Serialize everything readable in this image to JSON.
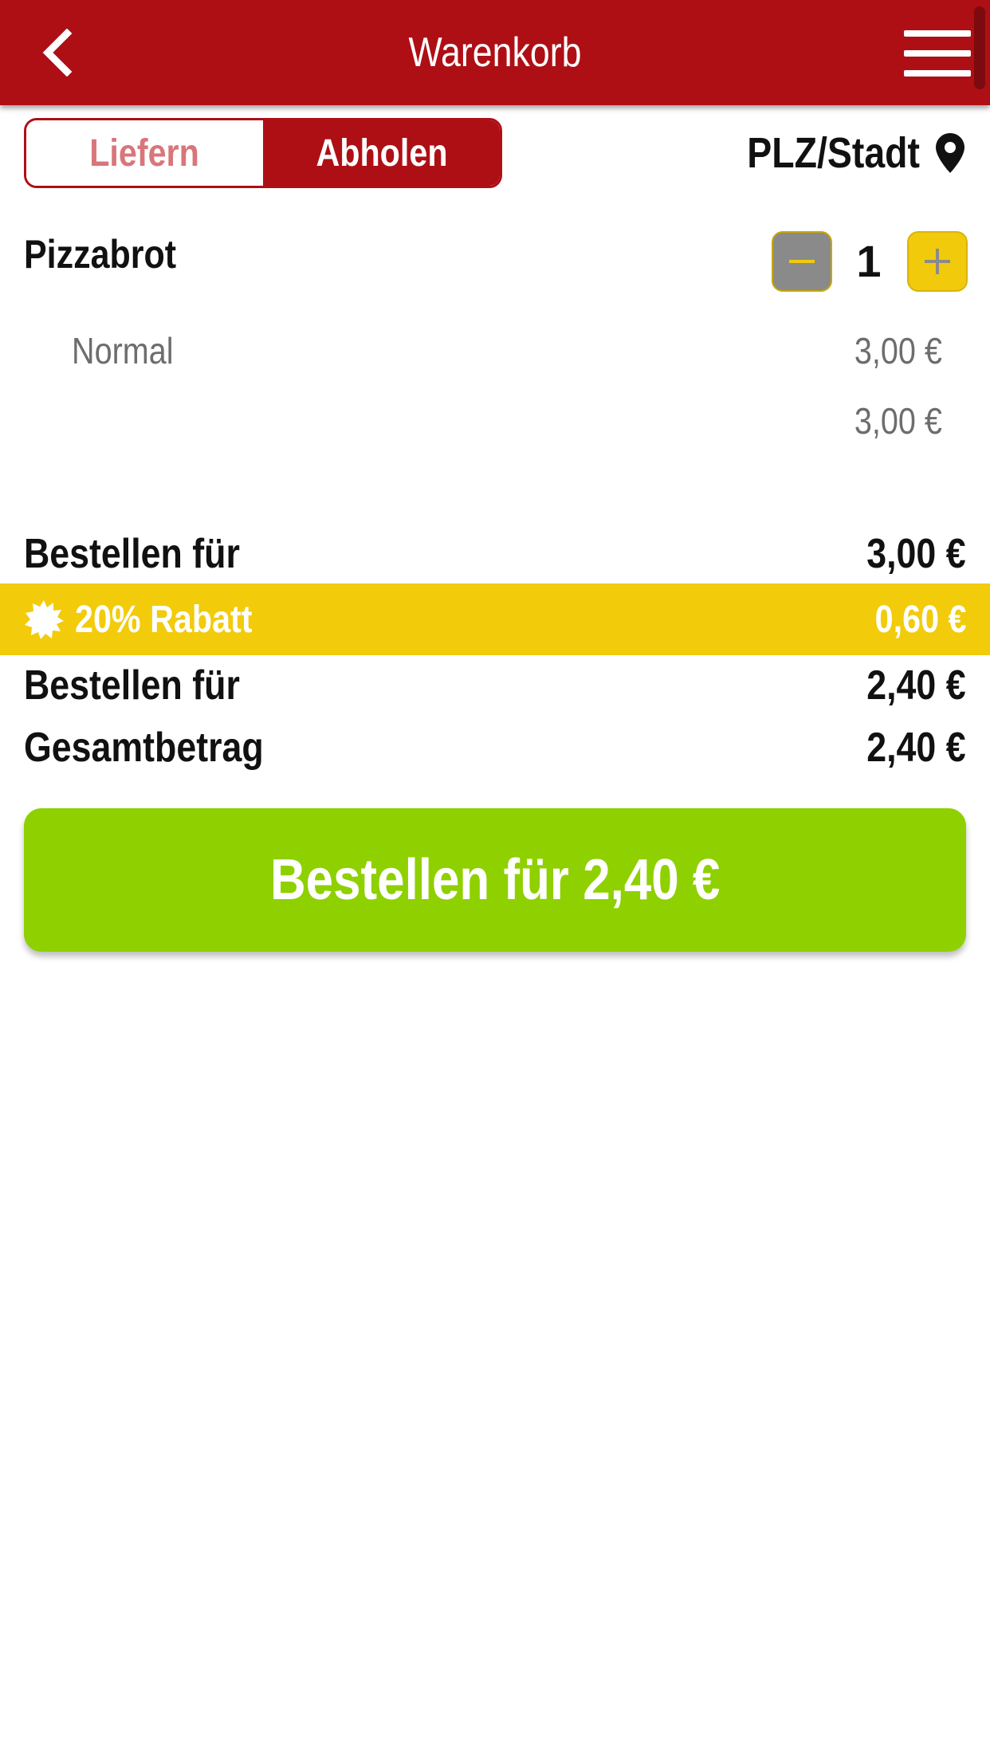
{
  "header": {
    "title": "Warenkorb",
    "back_icon": "chevron-left-icon",
    "menu_icon": "hamburger-menu-icon"
  },
  "mode_toggle": {
    "delivery_label": "Liefern",
    "pickup_label": "Abholen",
    "selected": "Abholen"
  },
  "location": {
    "label": "PLZ/Stadt",
    "icon": "map-pin-icon"
  },
  "cart": {
    "item": {
      "name": "Pizzabrot",
      "quantity": "1",
      "variant": "Normal",
      "variant_price": "3,00 €",
      "item_total": "3,00 €"
    }
  },
  "summary": {
    "subtotal_label": "Bestellen für",
    "subtotal_value": "3,00 €",
    "discount_label": "20% Rabatt",
    "discount_value": "0,60 €",
    "after_discount_label": "Bestellen für",
    "after_discount_value": "2,40 €",
    "total_label": "Gesamtbetrag",
    "total_value": "2,40 €"
  },
  "order_button": {
    "label": "Bestellen für 2,40 €"
  },
  "colors": {
    "brand_red": "#ae0f15",
    "accent_yellow": "#f2cb0b",
    "order_green": "#8fd000",
    "muted_pink": "#d8767b"
  }
}
